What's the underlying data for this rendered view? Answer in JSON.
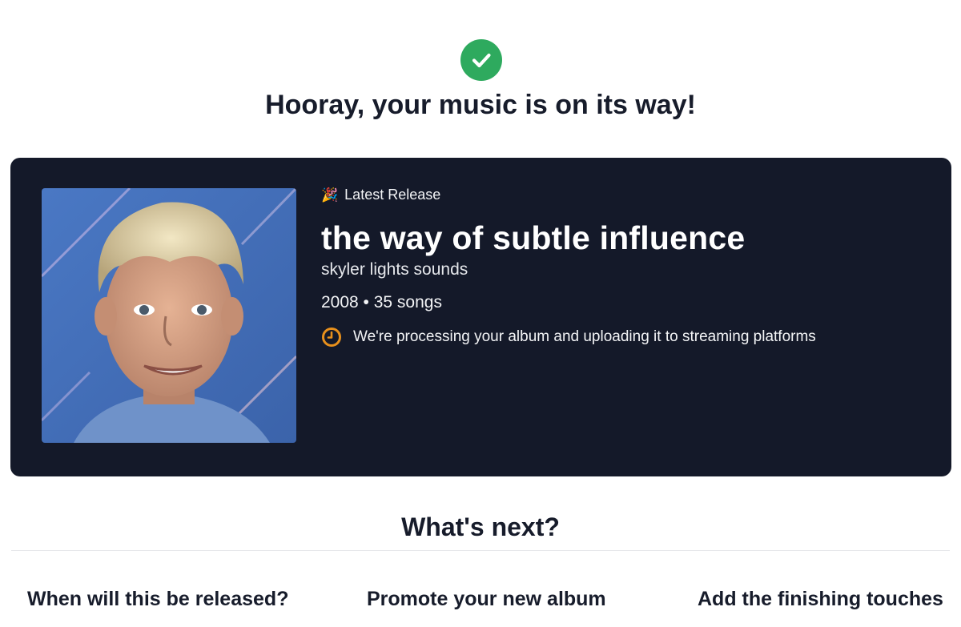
{
  "header": {
    "icon": "check-circle-icon",
    "success_color": "#2eaa5e",
    "title": "Hooray, your music is on its way!"
  },
  "release": {
    "tag_icon": "party-popper-icon",
    "tag_label": "Latest Release",
    "title": "the way of subtle influence",
    "artist": "skyler lights sounds",
    "meta": "2008 • 35 songs",
    "status_icon": "clock-icon",
    "status_color": "#e8901c",
    "status_text": "We're processing your album and uploading it to streaming platforms",
    "card_color": "#141929"
  },
  "next": {
    "heading": "What's next?",
    "items": [
      {
        "label": "When will this be released?"
      },
      {
        "label": "Promote your new album"
      },
      {
        "label": "Add the finishing touches"
      }
    ]
  }
}
